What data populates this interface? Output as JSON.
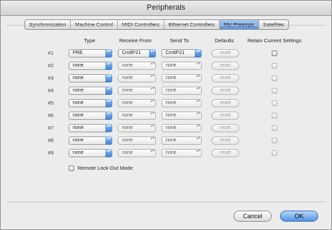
{
  "window": {
    "title": "Peripherals"
  },
  "tabs": [
    {
      "label": "Synchronization"
    },
    {
      "label": "Machine Control"
    },
    {
      "label": "MIDI Controllers"
    },
    {
      "label": "Ethernet Controllers"
    },
    {
      "label": "Mic Preamps",
      "active": true
    },
    {
      "label": "Satellites"
    }
  ],
  "columns": {
    "type": "Type",
    "receive_from": "Receive From",
    "send_to": "Send To",
    "defaults": "Defaults",
    "retain": "Retain Current Settings"
  },
  "rows": [
    {
      "label": "#1",
      "type": "PRE",
      "receive": "Cm8P21",
      "send": "Cm8P21",
      "reset": "reset"
    },
    {
      "label": "#2",
      "type": "none",
      "receive": "none",
      "send": "none",
      "reset": "reset"
    },
    {
      "label": "#3",
      "type": "none",
      "receive": "none",
      "send": "none",
      "reset": "reset"
    },
    {
      "label": "#4",
      "type": "none",
      "receive": "none",
      "send": "none",
      "reset": "reset"
    },
    {
      "label": "#5",
      "type": "none",
      "receive": "none",
      "send": "none",
      "reset": "reset"
    },
    {
      "label": "#6",
      "type": "none",
      "receive": "none",
      "send": "none",
      "reset": "reset"
    },
    {
      "label": "#7",
      "type": "none",
      "receive": "none",
      "send": "none",
      "reset": "reset"
    },
    {
      "label": "#8",
      "type": "none",
      "receive": "none",
      "send": "none",
      "reset": "reset"
    },
    {
      "label": "#9",
      "type": "none",
      "receive": "none",
      "send": "none",
      "reset": "reset"
    }
  ],
  "remote_lockout_label": "Remote Lock-Out Mode",
  "buttons": {
    "cancel": "Cancel",
    "ok": "OK"
  },
  "icons": {
    "popup_arrow": "updown-arrows-icon"
  },
  "colors": {
    "accent": "#5a93d9"
  }
}
